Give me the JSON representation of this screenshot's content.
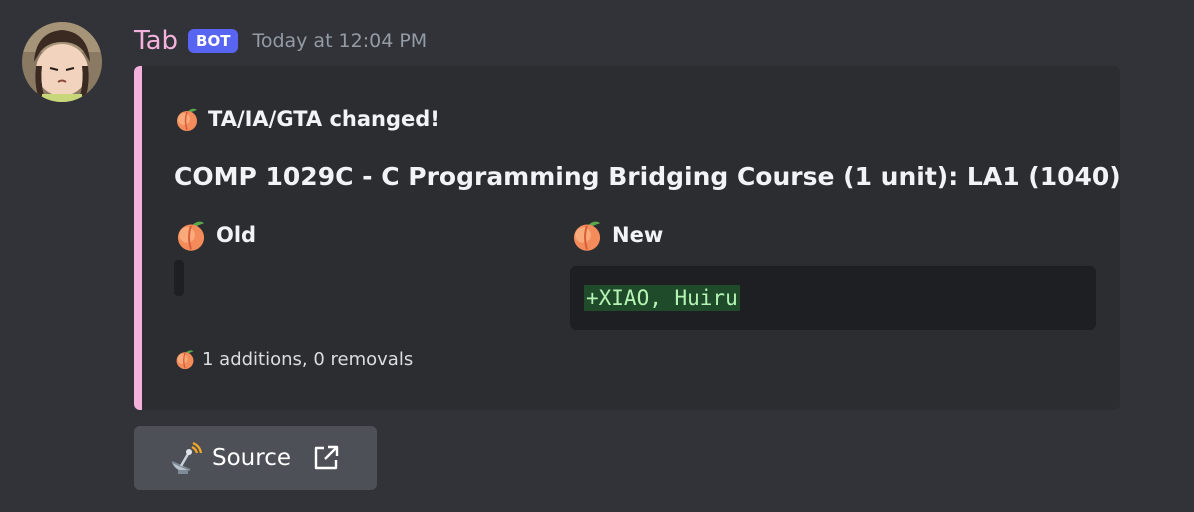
{
  "message": {
    "username": "Tab",
    "bot_tag": "BOT",
    "timestamp": "Today at 12:04 PM"
  },
  "embed": {
    "author": "TA/IA/GTA changed!",
    "title": "COMP 1029C - C Programming Bridging Course (1 unit): LA1 (1040)",
    "fields": [
      {
        "name": "Old",
        "value": ""
      },
      {
        "name": "New",
        "value": "+XIAO, Huiru"
      }
    ],
    "footer": "1 additions, 0 removals",
    "accent_color": "#f3b1dc",
    "author_icon": "peach-emoji-icon"
  },
  "button": {
    "label": "Source",
    "icon": "satellite-antenna-icon",
    "trailing_icon": "external-link-icon"
  }
}
